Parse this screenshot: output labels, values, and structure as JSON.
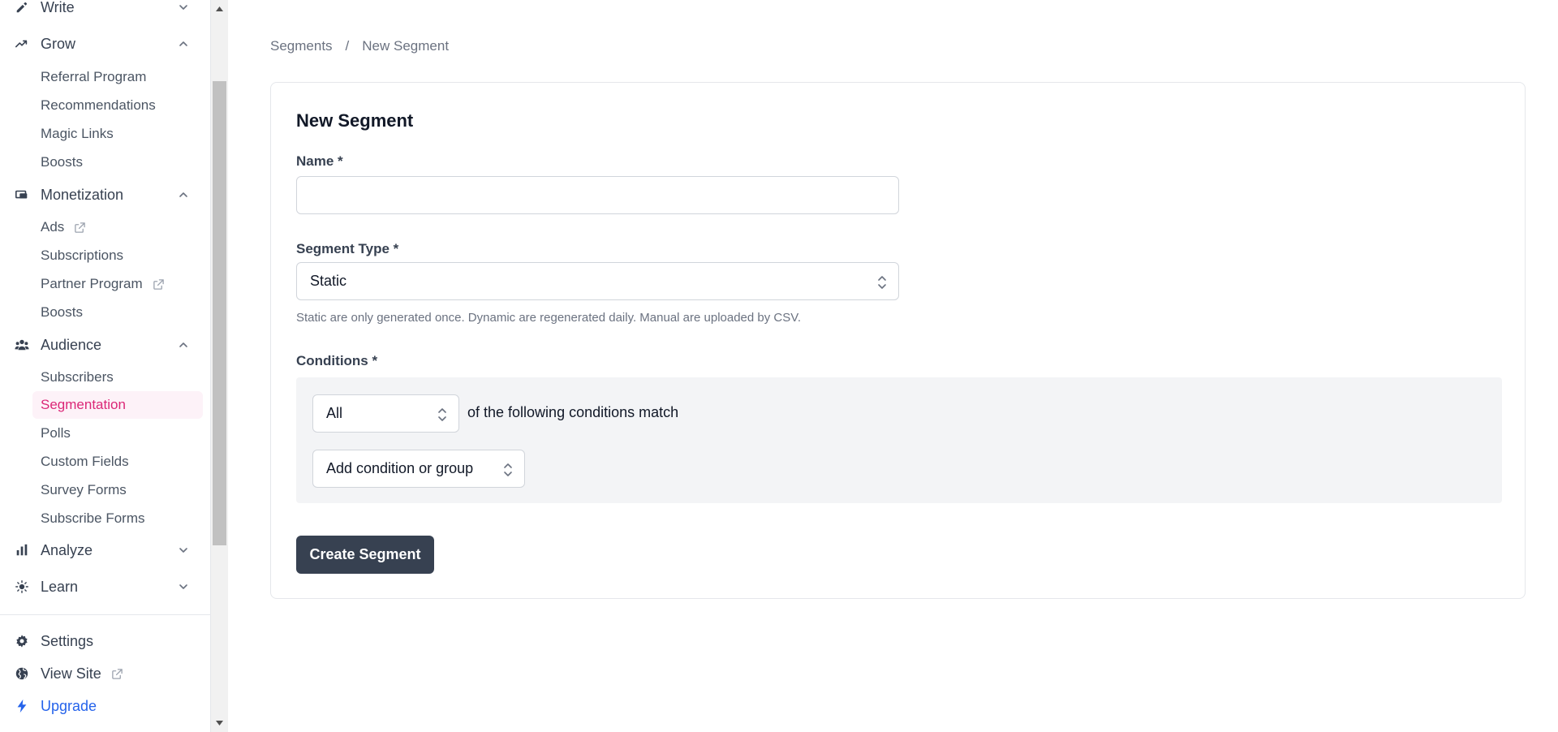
{
  "sidebar": {
    "write": {
      "label": "Write",
      "icon": "pencil-icon"
    },
    "grow": {
      "label": "Grow",
      "icon": "trending-up-icon",
      "items": [
        "Referral Program",
        "Recommendations",
        "Magic Links",
        "Boosts"
      ]
    },
    "monetization": {
      "label": "Monetization",
      "icon": "monetization-icon",
      "items": [
        "Ads",
        "Subscriptions",
        "Partner Program",
        "Boosts"
      ]
    },
    "audience": {
      "label": "Audience",
      "icon": "users-icon",
      "items": [
        "Subscribers",
        "Segmentation",
        "Polls",
        "Custom Fields",
        "Survey Forms",
        "Subscribe Forms"
      ],
      "active": "Segmentation"
    },
    "analyze": {
      "label": "Analyze",
      "icon": "bar-chart-icon"
    },
    "learn": {
      "label": "Learn",
      "icon": "lightbulb-icon"
    },
    "footer": {
      "settings": "Settings",
      "view_site": "View Site",
      "upgrade": "Upgrade"
    }
  },
  "breadcrumb": {
    "parent": "Segments",
    "separator": "/",
    "current": "New Segment"
  },
  "form": {
    "title": "New Segment",
    "name_label": "Name *",
    "name_value": "",
    "type_label": "Segment Type *",
    "type_value": "Static",
    "type_help": "Static are only generated once. Dynamic are regenerated daily. Manual are uploaded by CSV.",
    "conditions_label": "Conditions *",
    "match_value": "All",
    "match_text": "of the following conditions match",
    "add_condition": "Add condition or group",
    "submit": "Create Segment"
  },
  "colors": {
    "active_text": "#db2777",
    "active_bg": "#fdf2f8",
    "upgrade": "#2563eb",
    "button_bg": "#374151",
    "conditions_bg": "#f3f4f6"
  }
}
